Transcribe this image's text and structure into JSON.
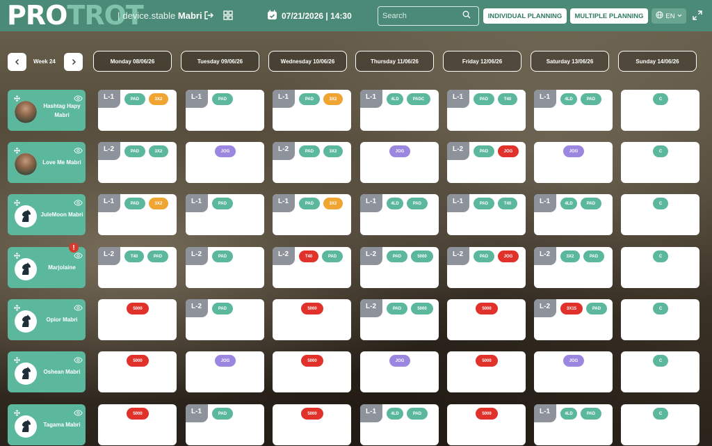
{
  "header": {
    "logo_pro": "PRO",
    "logo_trot": "TROT",
    "device_prefix": "|",
    "device_text": "device.stable",
    "stable_name": "Mabri",
    "datetime": "07/21/2026 | 14:30",
    "search_placeholder": "Search",
    "individual_planning": "INDIVIDUAL PLANNING",
    "multiple_planning": "MULTIPLE PLANNING",
    "language": "EN"
  },
  "week": {
    "label": "Week 24"
  },
  "days": [
    "Monday 08/06/26",
    "Tuesday 09/06/26",
    "Wednesday 10/06/26",
    "Thursday 11/06/26",
    "Friday 12/06/26",
    "Saturday 13/06/26",
    "Sunday 14/06/26"
  ],
  "colors": {
    "header_bg": "#4a8a76",
    "card_green": "#5cb89d",
    "pill_green": "#5cb89d",
    "pill_orange": "#f0a532",
    "pill_red": "#e0312a",
    "pill_purple": "#9b86e0",
    "level_badge": "#8e939b",
    "alert": "#d63b2f"
  },
  "horses": [
    {
      "name": "Hashtag Hapy Mabri",
      "avatar": "photo",
      "alert": "",
      "cells": [
        {
          "level": "L-1",
          "pills": [
            {
              "label": "PAD",
              "color": "green"
            },
            {
              "label": "3X2",
              "color": "orange"
            }
          ]
        },
        {
          "level": "L-1",
          "pills": [
            {
              "label": "PAD",
              "color": "green"
            }
          ]
        },
        {
          "level": "L-1",
          "pills": [
            {
              "label": "PAD",
              "color": "green"
            },
            {
              "label": "3X2",
              "color": "orange"
            }
          ]
        },
        {
          "level": "L-1",
          "pills": [
            {
              "label": "4LD",
              "color": "green"
            },
            {
              "label": "PADC",
              "color": "green"
            }
          ]
        },
        {
          "level": "L-1",
          "pills": [
            {
              "label": "PAD",
              "color": "green"
            },
            {
              "label": "T40",
              "color": "green"
            }
          ]
        },
        {
          "level": "L-1",
          "pills": [
            {
              "label": "4LD",
              "color": "green"
            },
            {
              "label": "PAD",
              "color": "green"
            }
          ]
        },
        {
          "level": "",
          "pills": [
            {
              "label": "C",
              "color": "green"
            }
          ]
        }
      ]
    },
    {
      "name": "Love Me Mabri",
      "avatar": "photo",
      "alert": "",
      "cells": [
        {
          "level": "L-2",
          "pills": [
            {
              "label": "PAD",
              "color": "green"
            },
            {
              "label": "3X2",
              "color": "green"
            }
          ]
        },
        {
          "level": "",
          "pills": [
            {
              "label": "JOG",
              "color": "purple"
            }
          ]
        },
        {
          "level": "L-2",
          "pills": [
            {
              "label": "PAD",
              "color": "green"
            },
            {
              "label": "3X2",
              "color": "green"
            }
          ]
        },
        {
          "level": "",
          "pills": [
            {
              "label": "JOG",
              "color": "purple"
            }
          ]
        },
        {
          "level": "L-2",
          "pills": [
            {
              "label": "PAD",
              "color": "green"
            },
            {
              "label": "JOG",
              "color": "red"
            }
          ]
        },
        {
          "level": "",
          "pills": [
            {
              "label": "JOG",
              "color": "purple"
            }
          ]
        },
        {
          "level": "",
          "pills": [
            {
              "label": "C",
              "color": "green"
            }
          ]
        }
      ]
    },
    {
      "name": "JuleMoon Mabri",
      "avatar": "horse",
      "alert": "",
      "cells": [
        {
          "level": "L-1",
          "pills": [
            {
              "label": "PAD",
              "color": "green"
            },
            {
              "label": "3X2",
              "color": "orange"
            }
          ]
        },
        {
          "level": "L-1",
          "pills": [
            {
              "label": "PAD",
              "color": "green"
            }
          ]
        },
        {
          "level": "L-1",
          "pills": [
            {
              "label": "PAD",
              "color": "green"
            },
            {
              "label": "3X2",
              "color": "orange"
            }
          ]
        },
        {
          "level": "L-1",
          "pills": [
            {
              "label": "4LD",
              "color": "green"
            },
            {
              "label": "PAD",
              "color": "green"
            }
          ]
        },
        {
          "level": "L-1",
          "pills": [
            {
              "label": "PAD",
              "color": "green"
            },
            {
              "label": "T40",
              "color": "green"
            }
          ]
        },
        {
          "level": "L-1",
          "pills": [
            {
              "label": "4LD",
              "color": "green"
            },
            {
              "label": "PAD",
              "color": "green"
            }
          ]
        },
        {
          "level": "",
          "pills": [
            {
              "label": "C",
              "color": "green"
            }
          ]
        }
      ]
    },
    {
      "name": "Marjolaine",
      "avatar": "horse",
      "alert": "!",
      "cells": [
        {
          "level": "L-2",
          "pills": [
            {
              "label": "T40",
              "color": "green"
            },
            {
              "label": "PAD",
              "color": "green"
            }
          ]
        },
        {
          "level": "L-2",
          "pills": [
            {
              "label": "PAD",
              "color": "green"
            }
          ]
        },
        {
          "level": "L-2",
          "pills": [
            {
              "label": "T40",
              "color": "red"
            },
            {
              "label": "PAD",
              "color": "green"
            }
          ]
        },
        {
          "level": "L-2",
          "pills": [
            {
              "label": "PAD",
              "color": "green"
            },
            {
              "label": "5000",
              "color": "green"
            }
          ]
        },
        {
          "level": "L-2",
          "pills": [
            {
              "label": "PAD",
              "color": "green"
            },
            {
              "label": "JOG",
              "color": "red"
            }
          ]
        },
        {
          "level": "L-2",
          "pills": [
            {
              "label": "3X2",
              "color": "green"
            },
            {
              "label": "PAD",
              "color": "green"
            }
          ]
        },
        {
          "level": "",
          "pills": [
            {
              "label": "C",
              "color": "green"
            }
          ]
        }
      ]
    },
    {
      "name": "Opior Mabri",
      "avatar": "horse",
      "alert": "",
      "cells": [
        {
          "level": "",
          "pills": [
            {
              "label": "5000",
              "color": "red"
            }
          ]
        },
        {
          "level": "L-2",
          "pills": [
            {
              "label": "PAD",
              "color": "green"
            }
          ]
        },
        {
          "level": "",
          "pills": [
            {
              "label": "5000",
              "color": "red"
            }
          ]
        },
        {
          "level": "L-2",
          "pills": [
            {
              "label": "PAD",
              "color": "green"
            },
            {
              "label": "5000",
              "color": "green"
            }
          ]
        },
        {
          "level": "",
          "pills": [
            {
              "label": "5000",
              "color": "red"
            }
          ]
        },
        {
          "level": "L-2",
          "pills": [
            {
              "label": "3X15",
              "color": "red"
            },
            {
              "label": "PAD",
              "color": "green"
            }
          ]
        },
        {
          "level": "",
          "pills": [
            {
              "label": "C",
              "color": "green"
            }
          ]
        }
      ]
    },
    {
      "name": "Oshean Mabri",
      "avatar": "horse",
      "alert": "",
      "cells": [
        {
          "level": "",
          "pills": [
            {
              "label": "5000",
              "color": "red"
            }
          ]
        },
        {
          "level": "",
          "pills": [
            {
              "label": "JOG",
              "color": "purple"
            }
          ]
        },
        {
          "level": "",
          "pills": [
            {
              "label": "5000",
              "color": "red"
            }
          ]
        },
        {
          "level": "",
          "pills": [
            {
              "label": "JOG",
              "color": "purple"
            }
          ]
        },
        {
          "level": "",
          "pills": [
            {
              "label": "5000",
              "color": "red"
            }
          ]
        },
        {
          "level": "",
          "pills": [
            {
              "label": "JOG",
              "color": "purple"
            }
          ]
        },
        {
          "level": "",
          "pills": [
            {
              "label": "C",
              "color": "green"
            }
          ]
        }
      ]
    },
    {
      "name": "Tagama Mabri",
      "avatar": "horse",
      "alert": "",
      "cells": [
        {
          "level": "",
          "pills": [
            {
              "label": "5000",
              "color": "red"
            }
          ]
        },
        {
          "level": "L-1",
          "pills": [
            {
              "label": "PAD",
              "color": "green"
            }
          ]
        },
        {
          "level": "",
          "pills": [
            {
              "label": "5000",
              "color": "red"
            }
          ]
        },
        {
          "level": "L-1",
          "pills": [
            {
              "label": "4LD",
              "color": "green"
            },
            {
              "label": "PAD",
              "color": "green"
            }
          ]
        },
        {
          "level": "",
          "pills": [
            {
              "label": "5000",
              "color": "red"
            }
          ]
        },
        {
          "level": "L-1",
          "pills": [
            {
              "label": "4LD",
              "color": "green"
            },
            {
              "label": "PAD",
              "color": "green"
            }
          ]
        },
        {
          "level": "",
          "pills": [
            {
              "label": "C",
              "color": "green"
            }
          ]
        }
      ]
    }
  ]
}
